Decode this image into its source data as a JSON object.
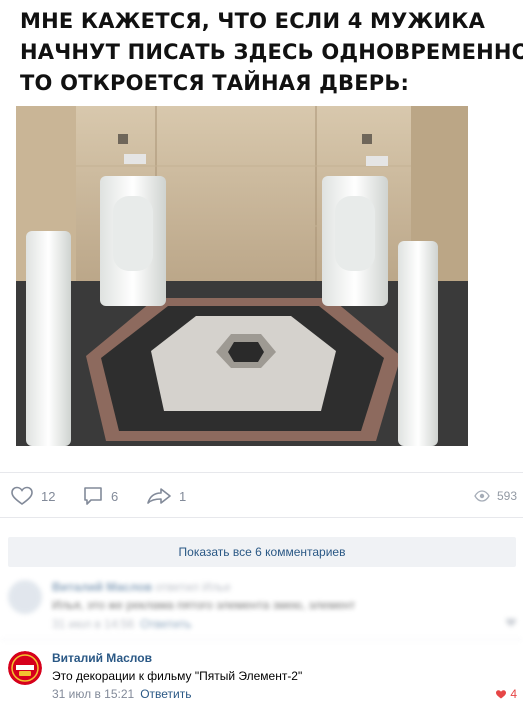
{
  "post": {
    "caption_lines": [
      "МНЕ КАЖЕТСЯ, ЧТО ЕСЛИ 4 МУЖИКА",
      "НАЧНУТ ПИСАТЬ ЗДЕСЬ ОДНОВРЕМЕННО,",
      "ТО ОТКРОЕТСЯ ТАЙНАЯ ДВЕРЬ:"
    ]
  },
  "actions": {
    "likes": "12",
    "comments": "6",
    "shares": "1",
    "views": "593"
  },
  "comments_section": {
    "show_all_label": "Показать все 6 комментариев",
    "blurred_comment": {
      "name": "Виталий Маслов",
      "reply_to": "ответил Илье",
      "text": "Илья, это же реклама пятого элемента змею, элемент",
      "date": "31 июл в 14:56",
      "reply_label": "Ответить"
    },
    "main_comment": {
      "name": "Виталий Маслов",
      "text": "Это декорации к фильму \"Пятый Элемент-2\"",
      "date": "31 июл в 15:21",
      "reply_label": "Ответить",
      "likes": "4"
    }
  },
  "colors": {
    "link": "#2a5885",
    "muted": "#828a99",
    "like_red": "#e64646"
  }
}
